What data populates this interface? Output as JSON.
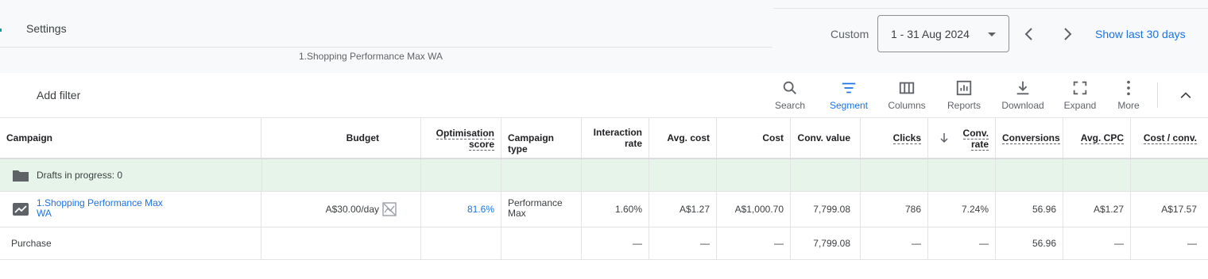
{
  "header": {
    "settings_label": "Settings",
    "campaign_breadcrumb": "1.Shopping Performance Max WA",
    "custom_label": "Custom",
    "date_range": "1 - 31 Aug 2024",
    "show_last": "Show last 30 days"
  },
  "toolbar": {
    "add_filter": "Add filter",
    "tools": [
      {
        "label": "Search",
        "icon": "search-icon"
      },
      {
        "label": "Segment",
        "icon": "segment-icon"
      },
      {
        "label": "Columns",
        "icon": "columns-icon"
      },
      {
        "label": "Reports",
        "icon": "reports-icon"
      },
      {
        "label": "Download",
        "icon": "download-icon"
      },
      {
        "label": "Expand",
        "icon": "expand-icon"
      },
      {
        "label": "More",
        "icon": "more-vert-icon"
      }
    ],
    "active_color": "#1a73e8"
  },
  "table": {
    "columns": [
      {
        "label": "Campaign"
      },
      {
        "label": "Budget"
      },
      {
        "label": "Optimisation score"
      },
      {
        "label": "Campaign type"
      },
      {
        "label": "Interaction rate"
      },
      {
        "label": "Avg. cost"
      },
      {
        "label": "Cost"
      },
      {
        "label": "Conv. value"
      },
      {
        "label": "Clicks"
      },
      {
        "label": "Conv. rate"
      },
      {
        "label": "Conversions"
      },
      {
        "label": "Avg. CPC"
      },
      {
        "label": "Cost / conv."
      }
    ],
    "drafts_label": "Drafts in progress: 0",
    "campaign_row": {
      "name": "1.Shopping Performance Max WA",
      "budget": "A$30.00/day",
      "opt_score": "81.6%",
      "type": "Performance Max",
      "interaction_rate": "1.60%",
      "avg_cost": "A$1.27",
      "cost": "A$1,000.70",
      "conv_value": "7,799.08",
      "clicks": "786",
      "conv_rate": "7.24%",
      "conversions": "56.96",
      "avg_cpc": "A$1.27",
      "cost_per_conv": "A$17.57"
    },
    "purchase_row": {
      "name": "Purchase",
      "interaction_rate": "—",
      "avg_cost": "—",
      "cost": "—",
      "conv_value": "7,799.08",
      "clicks": "—",
      "conv_rate": "—",
      "conversions": "56.96",
      "avg_cpc": "—",
      "cost_per_conv": "—"
    },
    "draft_row_color": "#e6f4ea"
  }
}
